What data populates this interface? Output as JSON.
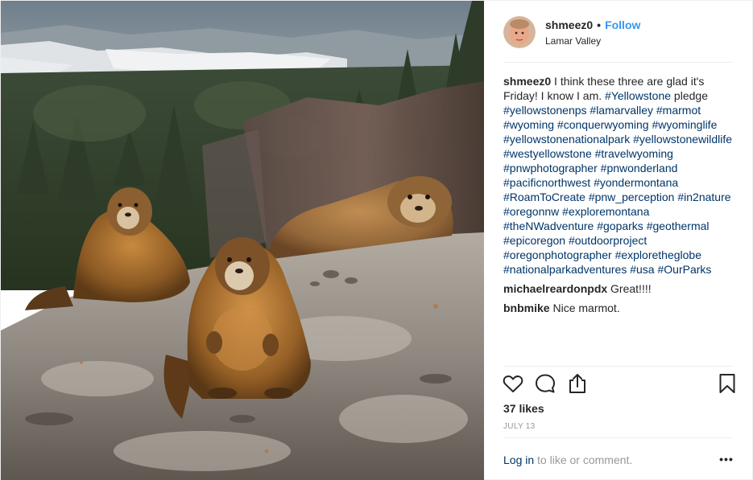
{
  "post": {
    "author": {
      "username": "shmeez0",
      "separator": "•",
      "follow_label": "Follow",
      "location": "Lamar Valley"
    },
    "caption": {
      "username": "shmeez0",
      "text": " I think these three are glad it's Friday! I know I am. ",
      "parts": [
        {
          "type": "tag",
          "text": "#Yellowstone"
        },
        {
          "type": "text",
          "text": " pledge "
        },
        {
          "type": "tag",
          "text": "#yellowstonenps"
        },
        {
          "type": "text",
          "text": " "
        },
        {
          "type": "tag",
          "text": "#lamarvalley"
        },
        {
          "type": "text",
          "text": " "
        },
        {
          "type": "tag",
          "text": "#marmot"
        },
        {
          "type": "text",
          "text": " "
        },
        {
          "type": "tag",
          "text": "#wyoming"
        },
        {
          "type": "text",
          "text": " "
        },
        {
          "type": "tag",
          "text": "#conquerwyoming"
        },
        {
          "type": "text",
          "text": " "
        },
        {
          "type": "tag",
          "text": "#wyominglife"
        },
        {
          "type": "text",
          "text": " "
        },
        {
          "type": "tag",
          "text": "#yellowstonenationalpark"
        },
        {
          "type": "text",
          "text": " "
        },
        {
          "type": "tag",
          "text": "#yellowstonewildlife"
        },
        {
          "type": "text",
          "text": " "
        },
        {
          "type": "tag",
          "text": "#westyellowstone"
        },
        {
          "type": "text",
          "text": " "
        },
        {
          "type": "tag",
          "text": "#travelwyoming"
        },
        {
          "type": "text",
          "text": " "
        },
        {
          "type": "tag",
          "text": "#pnwphotographer"
        },
        {
          "type": "text",
          "text": " "
        },
        {
          "type": "tag",
          "text": "#pnwonderland"
        },
        {
          "type": "text",
          "text": " "
        },
        {
          "type": "tag",
          "text": "#pacificnorthwest"
        },
        {
          "type": "text",
          "text": " "
        },
        {
          "type": "tag",
          "text": "#yondermontana"
        },
        {
          "type": "text",
          "text": " "
        },
        {
          "type": "tag",
          "text": "#RoamToCreate"
        },
        {
          "type": "text",
          "text": " "
        },
        {
          "type": "tag",
          "text": "#pnw_perception"
        },
        {
          "type": "text",
          "text": " "
        },
        {
          "type": "tag",
          "text": "#in2nature"
        },
        {
          "type": "text",
          "text": " "
        },
        {
          "type": "tag",
          "text": "#oregonnw"
        },
        {
          "type": "text",
          "text": " "
        },
        {
          "type": "tag",
          "text": "#exploremontana"
        },
        {
          "type": "text",
          "text": " "
        },
        {
          "type": "tag",
          "text": "#theNWadventure"
        },
        {
          "type": "text",
          "text": " "
        },
        {
          "type": "tag",
          "text": "#goparks"
        },
        {
          "type": "text",
          "text": " "
        },
        {
          "type": "tag",
          "text": "#geothermal"
        },
        {
          "type": "text",
          "text": " "
        },
        {
          "type": "tag",
          "text": "#epicoregon"
        },
        {
          "type": "text",
          "text": " "
        },
        {
          "type": "tag",
          "text": "#outdoorproject"
        },
        {
          "type": "text",
          "text": " "
        },
        {
          "type": "tag",
          "text": "#oregonphotographer"
        },
        {
          "type": "text",
          "text": " "
        },
        {
          "type": "tag",
          "text": "#exploretheglobe"
        },
        {
          "type": "text",
          "text": " "
        },
        {
          "type": "tag",
          "text": "#nationalparkadventures"
        },
        {
          "type": "text",
          "text": " "
        },
        {
          "type": "tag",
          "text": "#usa"
        },
        {
          "type": "text",
          "text": " "
        },
        {
          "type": "tag",
          "text": "#OurParks"
        }
      ]
    },
    "comments": [
      {
        "username": "michaelreardonpdx",
        "text": " Great!!!!"
      },
      {
        "username": "bnbmike",
        "text": " Nice marmot."
      }
    ],
    "actions": {
      "like_icon": "heart-icon",
      "comment_icon": "comment-bubble-icon",
      "share_icon": "share-icon",
      "save_icon": "bookmark-icon"
    },
    "likes": "37 likes",
    "date": "JULY 13",
    "login": {
      "link_label": "Log in",
      "rest": " to like or comment.",
      "more_label": "•••"
    }
  },
  "colors": {
    "link_blue": "#3897f0",
    "hashtag": "#003569",
    "muted": "#999999",
    "text": "#262626",
    "divider": "#efefef"
  }
}
